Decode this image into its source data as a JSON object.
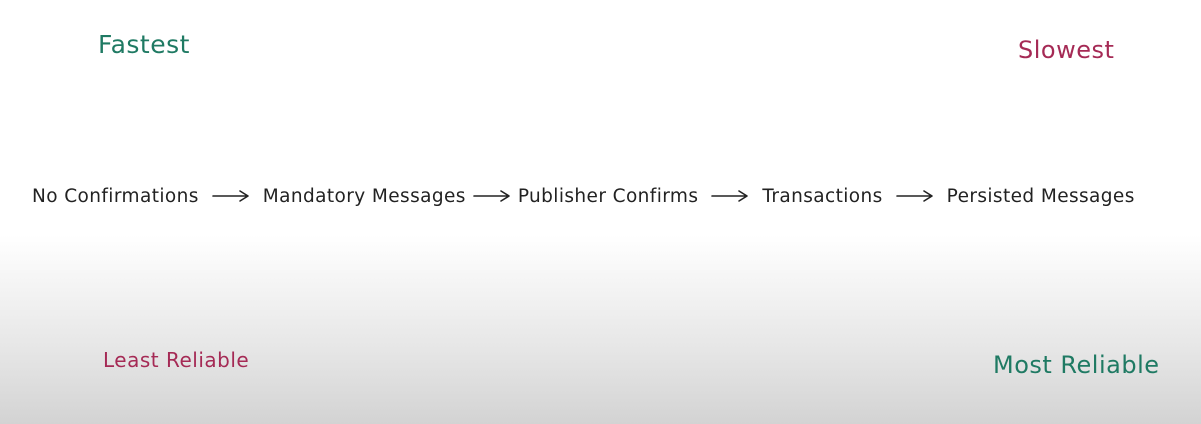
{
  "labels": {
    "fastest": "Fastest",
    "slowest": "Slowest",
    "least_reliable": "Least Reliable",
    "most_reliable": "Most Reliable"
  },
  "steps": [
    "No Confirmations",
    "Mandatory Messages",
    "Publisher Confirms",
    "Transactions",
    "Persisted Messages"
  ],
  "colors": {
    "speed_fast": "#1f7a63",
    "speed_slow": "#a52a55",
    "reliability_low": "#a52a55",
    "reliability_high": "#1f7a63",
    "text": "#222222"
  },
  "icons": {
    "flow_arrow": "arrow-right-icon"
  }
}
